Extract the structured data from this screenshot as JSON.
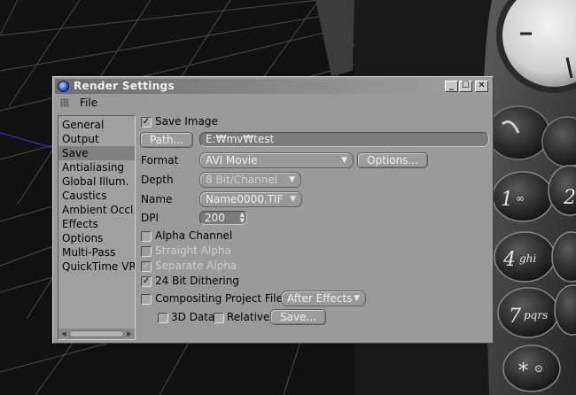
{
  "window": {
    "title": "Render Settings",
    "minimize": "_",
    "maximize": "☐",
    "close": "✕"
  },
  "menu": {
    "file": "File"
  },
  "nav": {
    "items": [
      {
        "label": "General"
      },
      {
        "label": "Output"
      },
      {
        "label": "Save"
      },
      {
        "label": "Antialiasing"
      },
      {
        "label": "Global Illum."
      },
      {
        "label": "Caustics"
      },
      {
        "label": "Ambient Occl."
      },
      {
        "label": "Effects"
      },
      {
        "label": "Options"
      },
      {
        "label": "Multi-Pass"
      },
      {
        "label": "QuickTime VR"
      }
    ],
    "selected": "Save"
  },
  "save": {
    "save_image": {
      "label": "Save Image",
      "checked": true
    },
    "path_button": "Path...",
    "path_value": "E:₩mv₩test",
    "format": {
      "label": "Format",
      "value": "AVI Movie"
    },
    "options_button": "Options...",
    "depth": {
      "label": "Depth",
      "value": "8 Bit/Channel"
    },
    "name": {
      "label": "Name",
      "value": "Name0000.TIF"
    },
    "dpi": {
      "label": "DPI",
      "value": "200"
    },
    "alpha_channel": {
      "label": "Alpha Channel",
      "checked": false
    },
    "straight_alpha": {
      "label": "Straight Alpha",
      "checked": false
    },
    "separate_alpha": {
      "label": "Separate Alpha",
      "checked": true
    },
    "dithering": {
      "label": "24 Bit Dithering",
      "checked": true
    },
    "compositing": {
      "label": "Compositing Project File",
      "checked": false,
      "value": "After Effects"
    },
    "data_3d": {
      "label": "3D Data",
      "checked": false
    },
    "relative": {
      "label": "Relative",
      "checked": false
    },
    "save_button": "Save..."
  },
  "phone_keys": [
    "1",
    "∞",
    "4",
    "ghi",
    "7",
    "pqrs",
    "*",
    "⊙",
    "2"
  ],
  "icons": {
    "app": "cinema4d-icon",
    "check": "✓",
    "dropdown": "▼",
    "spin_up": "▲",
    "spin_down": "▼",
    "scroll_left": "◀",
    "scroll_right": "▶"
  },
  "colors": {
    "window_bg": "#9a9a9a",
    "selected_nav": "#808080",
    "viewport_bg": "#111111"
  }
}
